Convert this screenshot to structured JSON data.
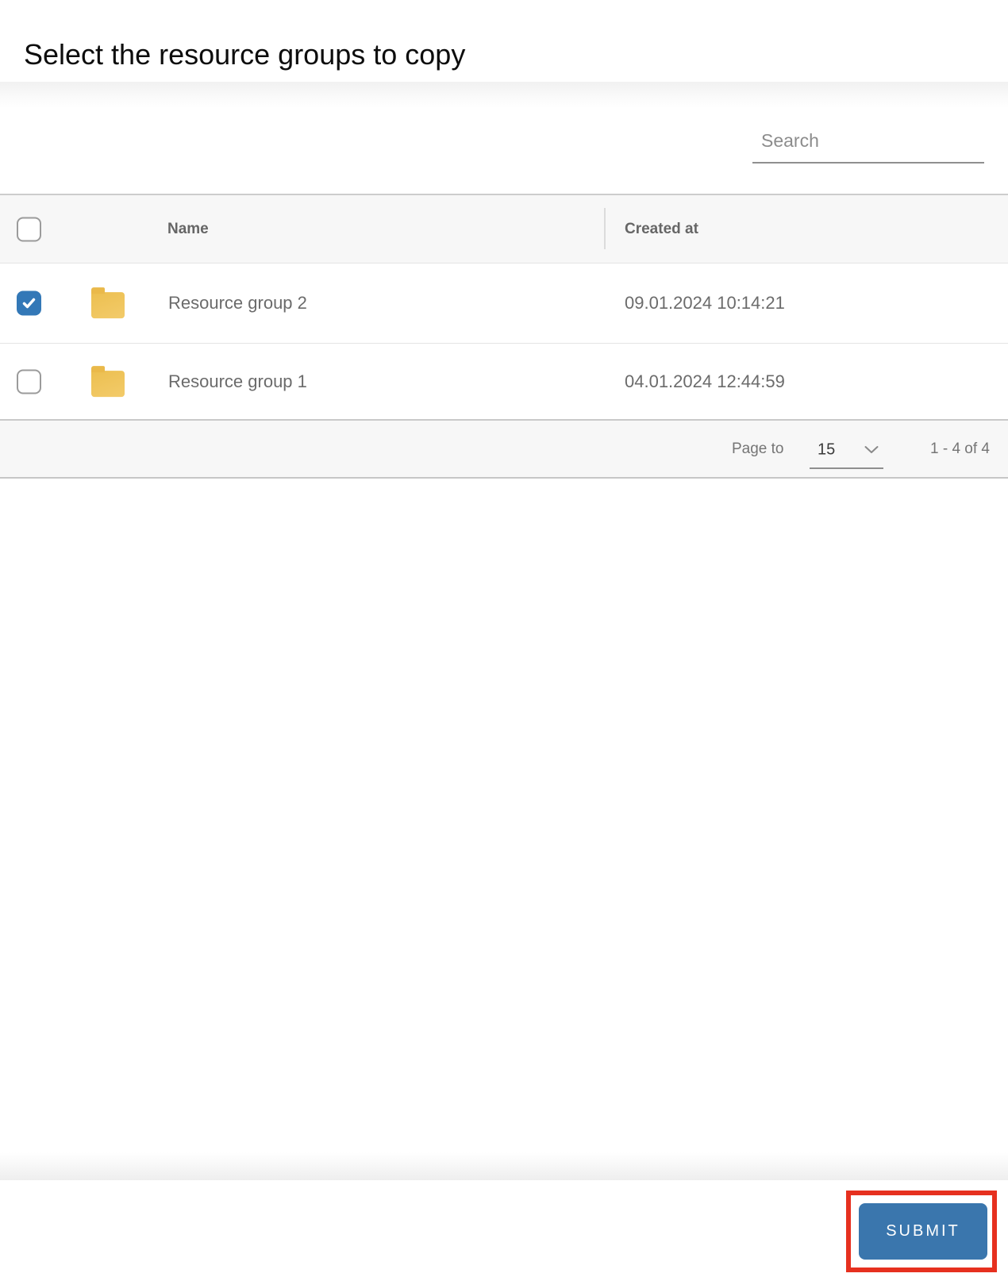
{
  "page": {
    "title": "Select the resource groups to copy"
  },
  "search": {
    "placeholder": "Search",
    "value": ""
  },
  "table": {
    "columns": {
      "name": "Name",
      "created_at": "Created at"
    },
    "rows": [
      {
        "name": "Resource group 2",
        "created_at": "09.01.2024 10:14:21",
        "selected": true
      },
      {
        "name": "Resource group 1",
        "created_at": "04.01.2024 12:44:59",
        "selected": false
      }
    ],
    "select_all_checked": false
  },
  "pagination": {
    "page_to_label": "Page to",
    "page_size": "15",
    "range_label": "1 - 4 of 4"
  },
  "actions": {
    "submit_label": "SUBMIT"
  },
  "icons": {
    "row_icon": "folder-icon",
    "page_size_icon": "chevron-down-icon",
    "checked_icon": "checkmark-icon"
  },
  "colors": {
    "checkbox_blue": "#3378b7",
    "button_blue": "#3a76ad",
    "folder_yellow": "#f0c45c",
    "annotation_red": "#e6301f",
    "band_gray": "#f7f7f7"
  }
}
